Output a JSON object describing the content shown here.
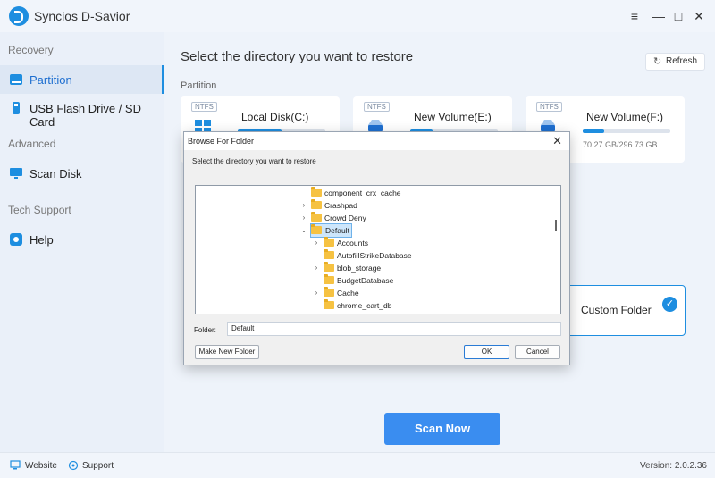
{
  "app": {
    "title": "Syncios D-Savior"
  },
  "window_controls": {
    "menu": "≡",
    "minimize": "—",
    "maximize": "□",
    "close": "✕"
  },
  "sidebar": {
    "sections": [
      {
        "heading": "Recovery",
        "items": [
          {
            "label": "Partition",
            "icon": "partition-icon",
            "active": true
          },
          {
            "label": "USB Flash Drive / SD Card",
            "icon": "usb-icon",
            "active": false
          }
        ]
      },
      {
        "heading": "Advanced",
        "items": [
          {
            "label": "Scan Disk",
            "icon": "scan-disk-icon",
            "active": false
          }
        ]
      },
      {
        "heading": "Tech Support",
        "items": [
          {
            "label": "Help",
            "icon": "help-icon",
            "active": false
          }
        ]
      }
    ]
  },
  "main": {
    "title": "Select the directory you want to restore",
    "refresh_label": "Refresh",
    "partition_label": "Partition",
    "disks": [
      {
        "fs": "NTFS",
        "name": "Local Disk(C:)",
        "usage_fraction": 0.5,
        "size_text": ""
      },
      {
        "fs": "NTFS",
        "name": "New Volume(E:)",
        "usage_fraction": 0.25,
        "size_text": ""
      },
      {
        "fs": "NTFS",
        "name": "New Volume(F:)",
        "usage_fraction": 0.24,
        "size_text": "70.27 GB/296.73 GB"
      }
    ],
    "custom_folder_label": "Custom Folder",
    "scan_button": "Scan Now"
  },
  "dialog": {
    "title": "Browse For Folder",
    "description": "Select the directory you want to restore",
    "tree": [
      {
        "label": "component_crx_cache",
        "level": 0,
        "chevron": ""
      },
      {
        "label": "Crashpad",
        "level": 0,
        "chevron": "›"
      },
      {
        "label": "Crowd Deny",
        "level": 0,
        "chevron": "›"
      },
      {
        "label": "Default",
        "level": 0,
        "chevron": "⌄",
        "selected": true
      },
      {
        "label": "Accounts",
        "level": 1,
        "chevron": "›"
      },
      {
        "label": "AutofillStrikeDatabase",
        "level": 1,
        "chevron": ""
      },
      {
        "label": "blob_storage",
        "level": 1,
        "chevron": "›"
      },
      {
        "label": "BudgetDatabase",
        "level": 1,
        "chevron": ""
      },
      {
        "label": "Cache",
        "level": 1,
        "chevron": "›"
      },
      {
        "label": "chrome_cart_db",
        "level": 1,
        "chevron": ""
      }
    ],
    "folder_label": "Folder:",
    "folder_value": "Default",
    "make_new_folder": "Make New Folder",
    "ok": "OK",
    "cancel": "Cancel"
  },
  "statusbar": {
    "website": "Website",
    "support": "Support",
    "version": "Version: 2.0.2.36"
  },
  "colors": {
    "accent": "#1e8ee0",
    "scan_button": "#3a8df0",
    "sidebar_bg": "#eaf0f9",
    "main_bg": "#eef3fa"
  }
}
